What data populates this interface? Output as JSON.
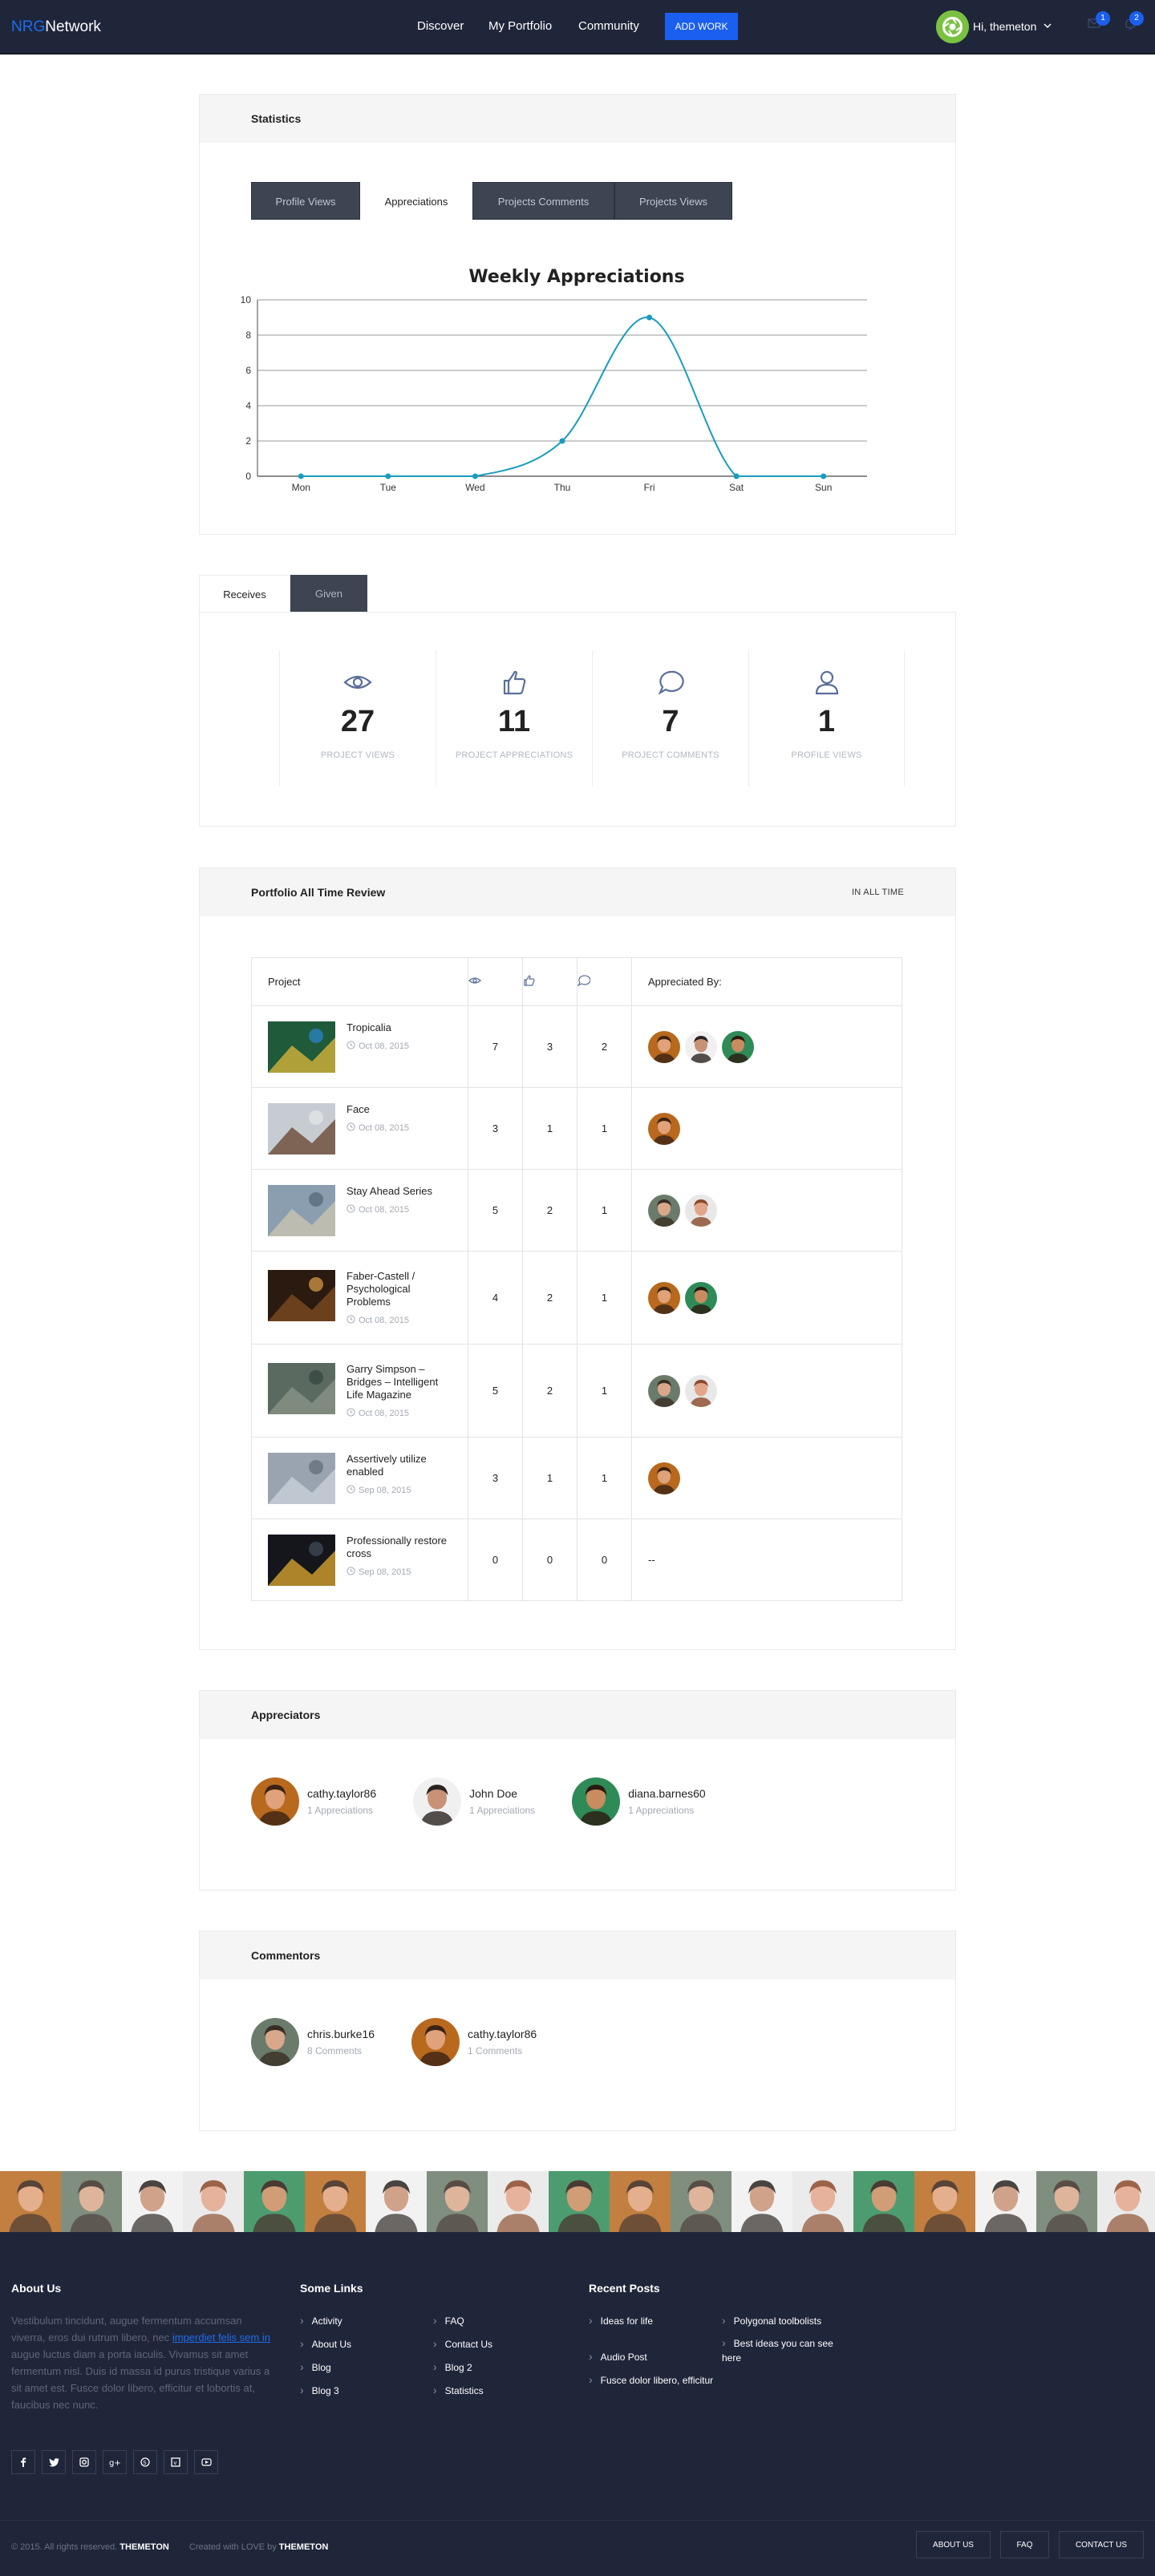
{
  "header": {
    "logo_brand": "NRG",
    "logo_rest": "Network",
    "nav": [
      "Discover",
      "My Portfolio",
      "Community"
    ],
    "add_work": "ADD WORK",
    "greeting": "Hi, themeton",
    "mail_badge": "1",
    "bell_badge": "2"
  },
  "statistics": {
    "title": "Statistics",
    "tabs": [
      "Profile Views",
      "Appreciations",
      "Projects Comments",
      "Projects Views"
    ],
    "active_tab": "Appreciations"
  },
  "chart_data": {
    "type": "line",
    "title": "Weekly Appreciations",
    "categories": [
      "Mon",
      "Tue",
      "Wed",
      "Thu",
      "Fri",
      "Sat",
      "Sun"
    ],
    "series": [
      {
        "values": [
          0,
          0,
          0,
          2,
          9,
          0,
          0
        ]
      }
    ],
    "ylim": [
      0,
      10
    ],
    "yticks": [
      "0",
      "2",
      "4",
      "6",
      "8",
      "10"
    ],
    "grid": true,
    "color": "#1a9bc0"
  },
  "summary": {
    "tabs": [
      "Receives",
      "Given"
    ],
    "active_tab": "Receives",
    "stats": [
      {
        "icon": "eye-icon",
        "value": "27",
        "label": "PROJECT VIEWS"
      },
      {
        "icon": "thumbs-up-icon",
        "value": "11",
        "label": "PROJECT APPRECIATIONS"
      },
      {
        "icon": "comment-icon",
        "value": "7",
        "label": "PROJECT COMMENTS"
      },
      {
        "icon": "user-icon",
        "value": "1",
        "label": "PROFILE VIEWS"
      }
    ]
  },
  "review": {
    "title": "Portfolio All Time Review",
    "range_link": "IN ALL TIME",
    "headers": {
      "project": "Project",
      "appreciated_by": "Appreciated By:"
    },
    "rows": [
      {
        "name": "Tropicalia",
        "date": "Oct 08, 2015",
        "views": "7",
        "likes": "3",
        "comments": "2",
        "avatars": [
          "a1",
          "a2",
          "a3"
        ]
      },
      {
        "name": "Face",
        "date": "Oct 08, 2015",
        "views": "3",
        "likes": "1",
        "comments": "1",
        "avatars": [
          "a1"
        ]
      },
      {
        "name": "Stay Ahead Series",
        "date": "Oct 08, 2015",
        "views": "5",
        "likes": "2",
        "comments": "1",
        "avatars": [
          "a4",
          "a5"
        ]
      },
      {
        "name": "Faber-Castell / Psychological Problems",
        "date": "Oct 08, 2015",
        "views": "4",
        "likes": "2",
        "comments": "1",
        "avatars": [
          "a1",
          "a3"
        ]
      },
      {
        "name": "Garry Simpson – Bridges – Intelligent Life Magazine",
        "date": "Oct 08, 2015",
        "views": "5",
        "likes": "2",
        "comments": "1",
        "avatars": [
          "a4",
          "a5"
        ]
      },
      {
        "name": "Assertively utilize enabled",
        "date": "Sep 08, 2015",
        "views": "3",
        "likes": "1",
        "comments": "1",
        "avatars": [
          "a1"
        ]
      },
      {
        "name": "Professionally restore cross",
        "date": "Sep 08, 2015",
        "views": "0",
        "likes": "0",
        "comments": "0",
        "avatars": [],
        "empty": "--"
      }
    ]
  },
  "appreciators": {
    "title": "Appreciators",
    "people": [
      {
        "name": "cathy.taylor86",
        "sub": "1 Appreciations"
      },
      {
        "name": "John Doe",
        "sub": "1 Appreciations"
      },
      {
        "name": "diana.barnes60",
        "sub": "1 Appreciations"
      }
    ]
  },
  "commentors": {
    "title": "Commentors",
    "people": [
      {
        "name": "chris.burke16",
        "sub": "8 Comments"
      },
      {
        "name": "cathy.taylor86",
        "sub": "1 Comments"
      }
    ]
  },
  "footer": {
    "about_title": "About Us",
    "about_text_1": "Vestibulum tincidunt, augue fermentum accumsan viverra, eros dui rutrum libero, nec ",
    "about_link": "imperdiet felis sem in",
    "about_text_2": " augue luctus diam a porta iaculis. Vivamus sit amet fermentum nisl. Duis id massa id purus tristique varius a sit amet est. Fusce dolor libero, efficitur et lobortis at, faucibus nec nunc.",
    "links_title": "Some Links",
    "links_col1": [
      "Activity",
      "About Us",
      "Blog",
      "Blog 3"
    ],
    "links_col2": [
      "FAQ",
      "Contact Us",
      "Blog 2",
      "Statistics"
    ],
    "posts_title": "Recent Posts",
    "posts_col1": [
      "Ideas for life",
      "Audio Post",
      "Fusce dolor libero, efficitur"
    ],
    "posts_col2": [
      "Polygonal toolbolists",
      "Best ideas you can see here"
    ],
    "social": [
      "facebook-icon",
      "twitter-icon",
      "instagram-icon",
      "google-plus-icon",
      "skype-icon",
      "vimeo-icon",
      "youtube-icon"
    ],
    "copyright": "© 2015. All rights reserved.",
    "copyright_brand": "THEMETON",
    "created": "Created with LOVE by",
    "created_brand": "THEMETON",
    "buttons": [
      "ABOUT US",
      "FAQ",
      "CONTACT US"
    ]
  }
}
